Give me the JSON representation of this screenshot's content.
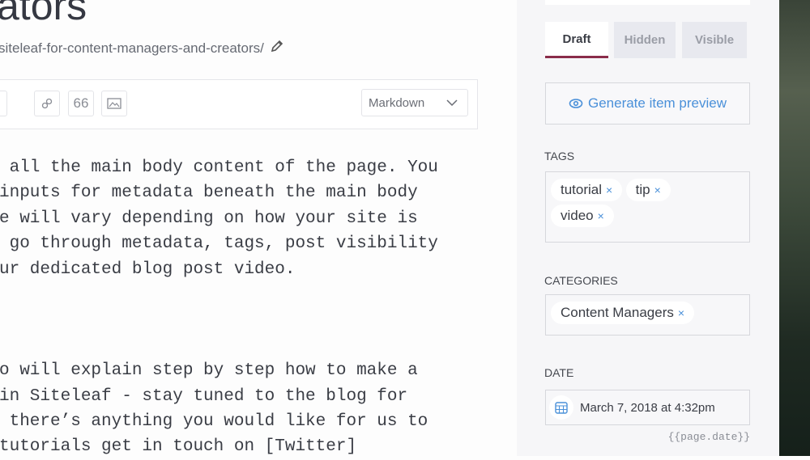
{
  "editor": {
    "title": "ators",
    "url": "siteleaf-for-content-managers-and-creators/",
    "toolbar": {
      "format_select": "Markdown"
    },
    "body_lines": [
      " all the main body content of the page. You",
      "inputs for metadata beneath the main body",
      "e will vary depending on how your site is",
      " go through metadata, tags, post visibility",
      "ur dedicated blog post video.",
      "",
      "",
      "",
      "o will explain step by step how to make a",
      "in Siteleaf - stay tuned to the blog for",
      " there’s anything you would like for us to",
      "tutorials get in touch on [Twitter]"
    ]
  },
  "sidebar": {
    "tabs": [
      {
        "label": "Draft",
        "active": true
      },
      {
        "label": "Hidden"
      },
      {
        "label": "Visible"
      }
    ],
    "preview_button": "Generate item preview",
    "tags_label": "TAGS",
    "tags": [
      "tutorial",
      "tip",
      "video"
    ],
    "categories_label": "CATEGORIES",
    "categories": [
      "Content Managers"
    ],
    "date_label": "DATE",
    "date_value": "March 7, 2018 at 4:32pm",
    "date_hint": "{{page.date}}",
    "remove_glyph": "×"
  },
  "colors": {
    "accent": "#4a90d9",
    "active_tab_underline": "#8a2c4a"
  }
}
